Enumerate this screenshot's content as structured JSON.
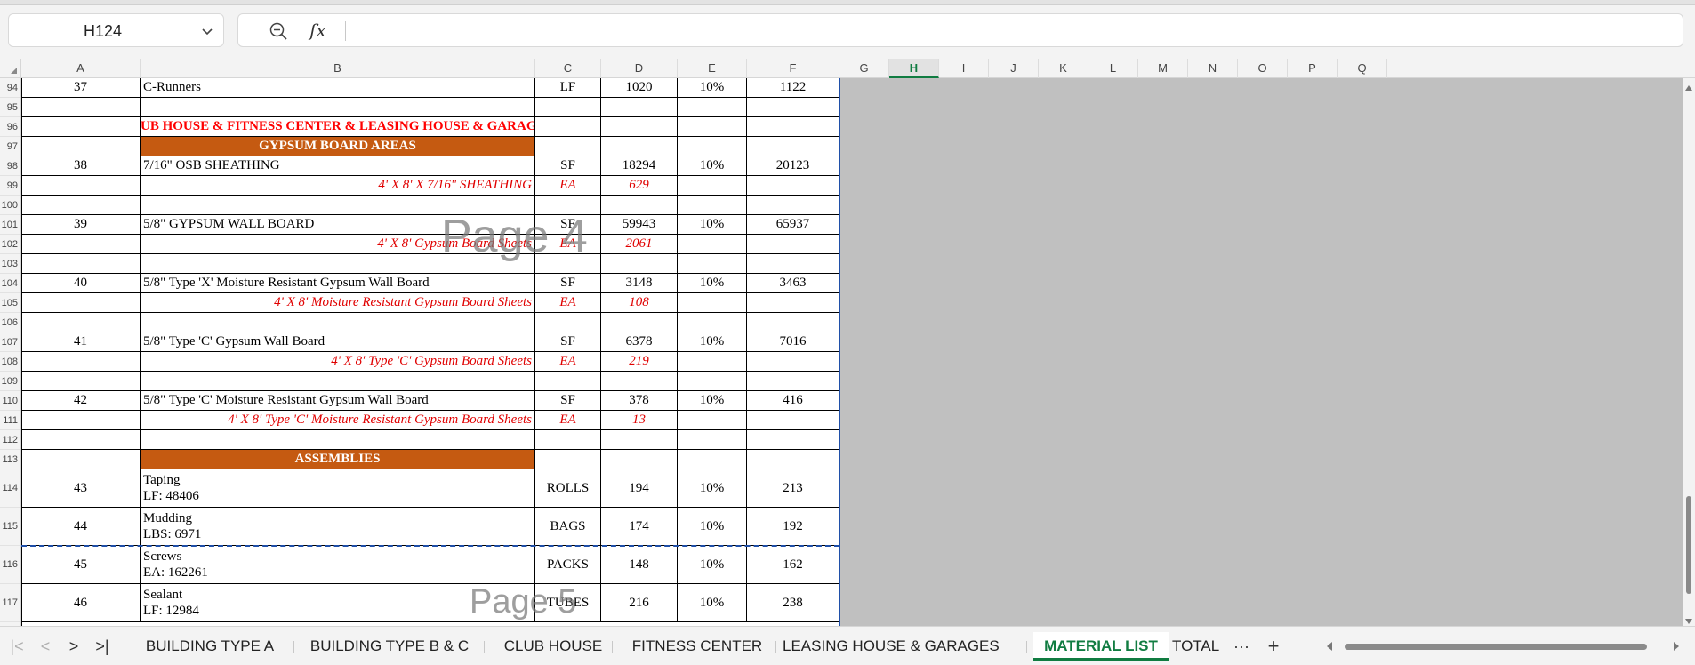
{
  "formula_bar": {
    "name_box": "H124",
    "fx_label": "fx",
    "formula": ""
  },
  "columns": [
    "A",
    "B",
    "C",
    "D",
    "E",
    "F",
    "G",
    "H",
    "I",
    "J",
    "K",
    "L",
    "M",
    "N",
    "O",
    "P",
    "Q"
  ],
  "selected_column": "H",
  "rows": [
    {
      "num": "94",
      "a": "37",
      "b": "C-Runners",
      "c": "LF",
      "d": "1020",
      "e": "10%",
      "f": "1122",
      "kind": "item"
    },
    {
      "num": "95",
      "kind": "blank"
    },
    {
      "num": "96",
      "b": "CLUB HOUSE & FITNESS CENTER & LEASING HOUSE & GARAGES",
      "kind": "title"
    },
    {
      "num": "97",
      "b": "GYPSUM BOARD AREAS",
      "kind": "section"
    },
    {
      "num": "98",
      "a": "38",
      "b": "7/16\" OSB SHEATHING",
      "c": "SF",
      "d": "18294",
      "e": "10%",
      "f": "20123",
      "kind": "item"
    },
    {
      "num": "99",
      "b": "4' X 8' X 7/16\" SHEATHING",
      "c": "EA",
      "d": "629",
      "kind": "sub"
    },
    {
      "num": "100",
      "kind": "blank"
    },
    {
      "num": "101",
      "a": "39",
      "b": "5/8\" GYPSUM WALL BOARD",
      "c": "SF",
      "d": "59943",
      "e": "10%",
      "f": "65937",
      "kind": "item"
    },
    {
      "num": "102",
      "b": "4' X 8' Gypsum Board Sheets",
      "c": "EA",
      "d": "2061",
      "kind": "sub"
    },
    {
      "num": "103",
      "kind": "blank"
    },
    {
      "num": "104",
      "a": "40",
      "b": "5/8\" Type 'X' Moisture Resistant Gypsum Wall Board",
      "c": "SF",
      "d": "3148",
      "e": "10%",
      "f": "3463",
      "kind": "item"
    },
    {
      "num": "105",
      "b": "4' X 8' Moisture Resistant Gypsum Board Sheets",
      "c": "EA",
      "d": "108",
      "kind": "sub"
    },
    {
      "num": "106",
      "kind": "blank"
    },
    {
      "num": "107",
      "a": "41",
      "b": "5/8\" Type 'C' Gypsum Wall Board",
      "c": "SF",
      "d": "6378",
      "e": "10%",
      "f": "7016",
      "kind": "item"
    },
    {
      "num": "108",
      "b": "4' X 8' Type 'C' Gypsum Board Sheets",
      "c": "EA",
      "d": "219",
      "kind": "sub"
    },
    {
      "num": "109",
      "kind": "blank"
    },
    {
      "num": "110",
      "a": "42",
      "b": "5/8\" Type 'C' Moisture Resistant Gypsum Wall Board",
      "c": "SF",
      "d": "378",
      "e": "10%",
      "f": "416",
      "kind": "item"
    },
    {
      "num": "111",
      "b": "4' X 8' Type 'C' Moisture Resistant Gypsum Board Sheets",
      "c": "EA",
      "d": "13",
      "kind": "sub"
    },
    {
      "num": "112",
      "kind": "blank"
    },
    {
      "num": "113",
      "b": "ASSEMBLIES",
      "kind": "section"
    },
    {
      "num": "114",
      "a": "43",
      "b": "Taping",
      "b2": "LF: 48406",
      "c": "ROLLS",
      "d": "194",
      "e": "10%",
      "f": "213",
      "kind": "multi"
    },
    {
      "num": "115",
      "a": "44",
      "b": "Mudding",
      "b2": "LBS: 6971",
      "c": "BAGS",
      "d": "174",
      "e": "10%",
      "f": "192",
      "kind": "multi"
    },
    {
      "num": "116",
      "a": "45",
      "b": "Screws",
      "b2": "EA: 162261",
      "c": "PACKS",
      "d": "148",
      "e": "10%",
      "f": "162",
      "kind": "multi"
    },
    {
      "num": "117",
      "a": "46",
      "b": "Sealant",
      "b2": "LF: 12984",
      "c": "TUBES",
      "d": "216",
      "e": "10%",
      "f": "238",
      "kind": "multi"
    }
  ],
  "watermarks": [
    "Page 4",
    "Page 5"
  ],
  "sheet_tabs": [
    "BUILDING TYPE A",
    "BUILDING TYPE B & C",
    "CLUB HOUSE",
    "FITNESS CENTER",
    "LEASING HOUSE & GARAGES",
    "MATERIAL LIST",
    "TOTAL"
  ],
  "active_tab": "MATERIAL LIST",
  "tab_nav": {
    "first": "|<",
    "prev": "<",
    "next": ">",
    "last": ">|",
    "more": "···",
    "add": "+"
  },
  "colors": {
    "accent": "#107c41",
    "section_fill": "#c55a11",
    "red_text": "#e00000",
    "page_break": "#1f4fa8"
  }
}
